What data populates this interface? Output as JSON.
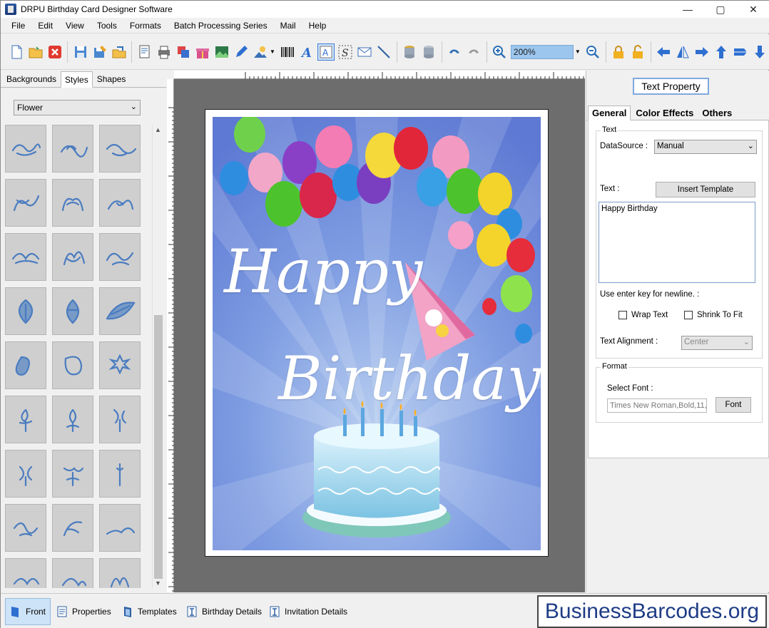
{
  "window": {
    "title": "DRPU Birthday Card Designer Software",
    "minimize": "—",
    "maximize": "▢",
    "close": "✕"
  },
  "menu": [
    "File",
    "Edit",
    "View",
    "Tools",
    "Formats",
    "Batch Processing Series",
    "Mail",
    "Help"
  ],
  "toolbar": {
    "zoom_value": "200%"
  },
  "left_panel": {
    "tabs": [
      "Backgrounds",
      "Styles",
      "Shapes"
    ],
    "active_tab": "Styles",
    "category": "Flower"
  },
  "card": {
    "line1": "Happy",
    "line2": "Birthday"
  },
  "right_panel": {
    "title": "Text Property",
    "tabs": [
      "General",
      "Color Effects",
      "Others"
    ],
    "text_group": "Text",
    "datasource_label": "DataSource :",
    "datasource_value": "Manual",
    "text_label": "Text :",
    "insert_template": "Insert Template",
    "text_value": "Happy Birthday",
    "newline_hint": "Use enter key for newline. :",
    "wrap_text": "Wrap Text",
    "shrink_to_fit": "Shrink To Fit",
    "alignment_label": "Text Alignment :",
    "alignment_value": "Center",
    "format_group": "Format",
    "select_font_label": "Select Font :",
    "font_value": "Times New Roman,Bold,11,8",
    "font_button": "Font"
  },
  "bottom_tabs": [
    "Front",
    "Properties",
    "Templates",
    "Birthday Details",
    "Invitation Details"
  ],
  "brand": "BusinessBarcodes.org"
}
